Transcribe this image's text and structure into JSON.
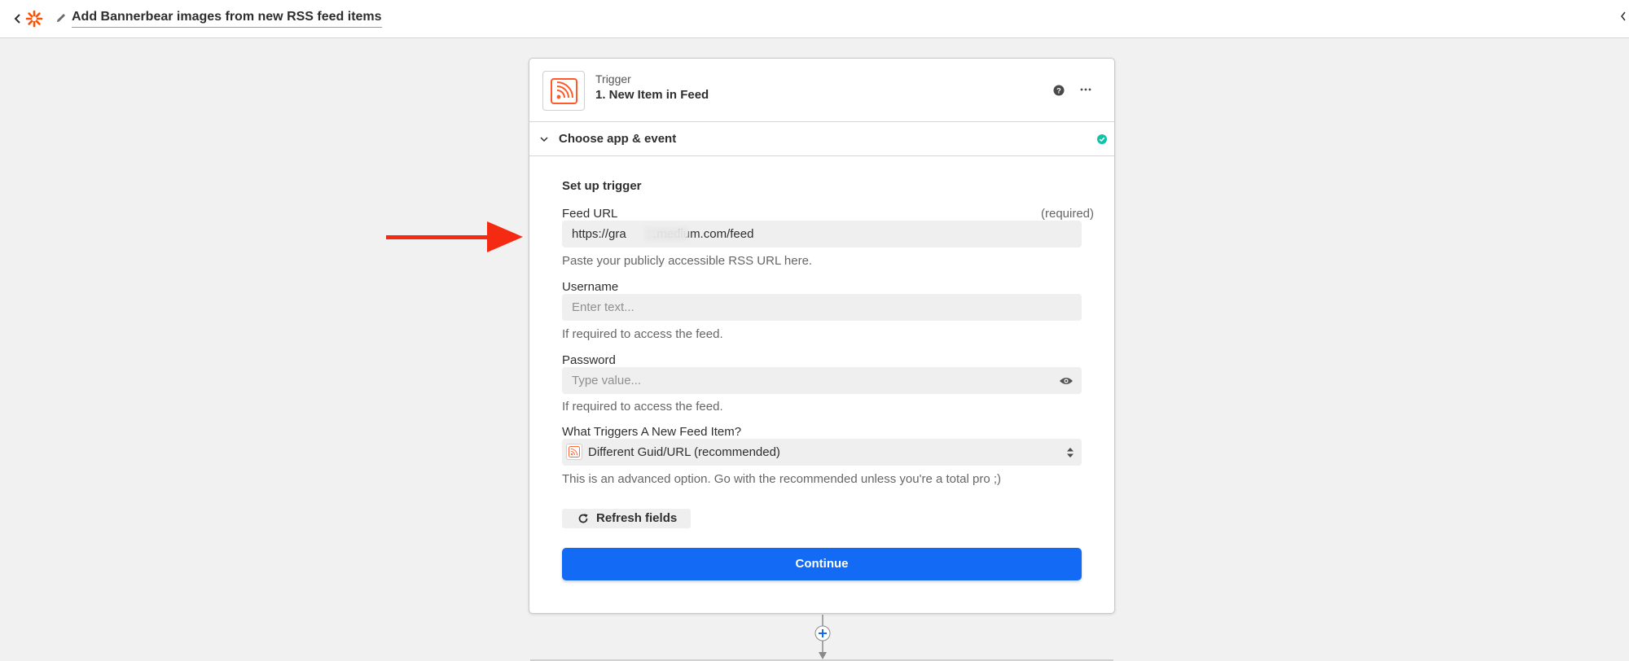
{
  "header": {
    "zap_title": "Add Bannerbear images from new RSS feed items",
    "icons": [
      "chevron-left-icon",
      "zapier-logo",
      "pencil-icon"
    ]
  },
  "step": {
    "kicker": "Trigger",
    "title": "1. New Item in Feed",
    "app_icon": "rss-icon",
    "header_icons": [
      "help-icon",
      "more-icon"
    ]
  },
  "section": {
    "label": "Choose app & event",
    "status_icon": "check-circle-icon"
  },
  "setup": {
    "title": "Set up trigger",
    "feed_url": {
      "label": "Feed URL",
      "required": "(required)",
      "value": "https://gra        .medium.com/feed",
      "helper": "Paste your publicly accessible RSS URL here."
    },
    "username": {
      "label": "Username",
      "placeholder": "Enter text...",
      "helper": "If required to access the feed."
    },
    "password": {
      "label": "Password",
      "placeholder": "Type value...",
      "helper": "If required to access the feed."
    },
    "trigger_type": {
      "label": "What Triggers A New Feed Item?",
      "value": "Different Guid/URL (recommended)",
      "helper": "This is an advanced option. Go with the recommended unless you're a total pro ;)"
    },
    "refresh_label": "Refresh fields",
    "continue_label": "Continue"
  },
  "colors": {
    "brand_orange": "#ff4f00",
    "primary_blue": "#136bf5",
    "success_green": "#13c0a8",
    "annotation_red": "#f52a12"
  }
}
